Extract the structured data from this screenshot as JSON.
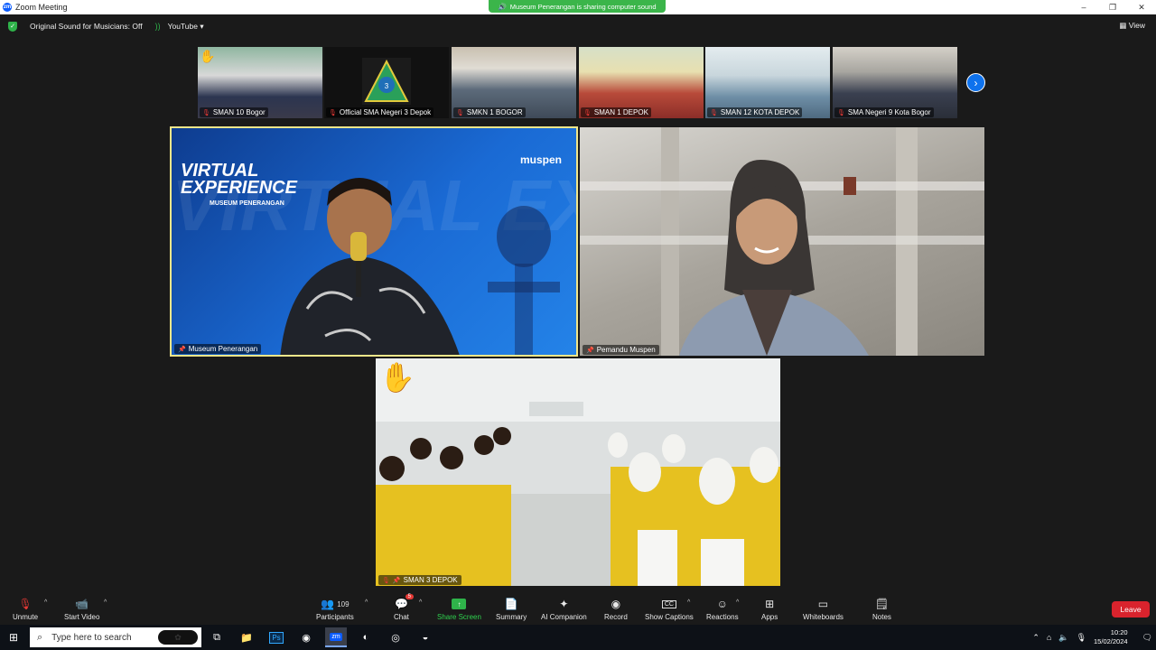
{
  "window": {
    "title": "Zoom Meeting",
    "sharing_notice": "Museum Penerangan is sharing computer sound",
    "controls": [
      "–",
      "❐",
      "✕"
    ]
  },
  "infobar": {
    "original_sound": "Original Sound for Musicians: Off",
    "stream": "YouTube",
    "view": "View"
  },
  "thumbnails": [
    {
      "name": "SMAN 10 Bogor",
      "muted": true,
      "hand_raised": true
    },
    {
      "name": "Official SMA Negeri 3 Depok",
      "muted": true,
      "hand_raised": false
    },
    {
      "name": "SMKN 1 BOGOR",
      "muted": true,
      "hand_raised": false
    },
    {
      "name": "SMAN 1 DEPOK",
      "muted": true,
      "hand_raised": false
    },
    {
      "name": "SMAN 12 KOTA DEPOK",
      "muted": true,
      "hand_raised": false
    },
    {
      "name": "SMA Negeri 9  Kota Bogor",
      "muted": true,
      "hand_raised": false
    }
  ],
  "tiles": {
    "left": {
      "name": "Museum Penerangan",
      "banner_title_1": "VIRTUAL",
      "banner_title_2": "EXPERIENCE",
      "banner_sub": "MUSEUM PENERANGAN",
      "logo": "muspen",
      "bg_text": "VIRTUAL EXPERIENCE"
    },
    "right": {
      "name": "Pemandu Muspen"
    },
    "bottom": {
      "name": "SMAN 3 DEPOK",
      "hand_raised": true
    }
  },
  "toolbar": {
    "unmute": "Unmute",
    "start_video": "Start Video",
    "participants": "Participants",
    "participants_count": "109",
    "chat": "Chat",
    "chat_badge": "5",
    "share_screen": "Share Screen",
    "summary": "Summary",
    "ai_companion": "AI Companion",
    "record": "Record",
    "show_captions": "Show Captions",
    "reactions": "Reactions",
    "apps": "Apps",
    "whiteboards": "Whiteboards",
    "notes": "Notes",
    "leave": "Leave",
    "colors": {
      "accent": "#0e72ed",
      "share": "#2fb34a",
      "leave": "#d9232d",
      "active_speaker": "#f2e78a"
    }
  },
  "taskbar": {
    "search_placeholder": "Type here to search",
    "time": "10:20",
    "date": "15/02/2024"
  }
}
